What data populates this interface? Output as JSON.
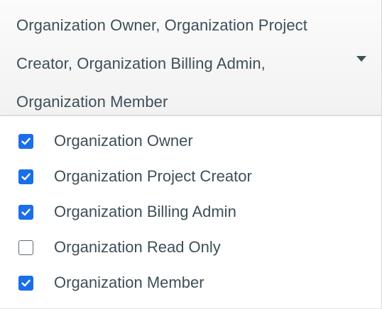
{
  "select": {
    "value_lines": [
      "Organization Owner, Organization Project",
      "Creator, Organization Billing Admin,",
      "Organization Member"
    ],
    "icon": "caret-down-icon"
  },
  "options": [
    {
      "label": "Organization Owner",
      "checked": true
    },
    {
      "label": "Organization Project Creator",
      "checked": true
    },
    {
      "label": "Organization Billing Admin",
      "checked": true
    },
    {
      "label": "Organization Read Only",
      "checked": false
    },
    {
      "label": "Organization Member",
      "checked": true
    }
  ],
  "colors": {
    "checkbox_checked": "#1a6fe8",
    "text": "#3d4f58"
  }
}
